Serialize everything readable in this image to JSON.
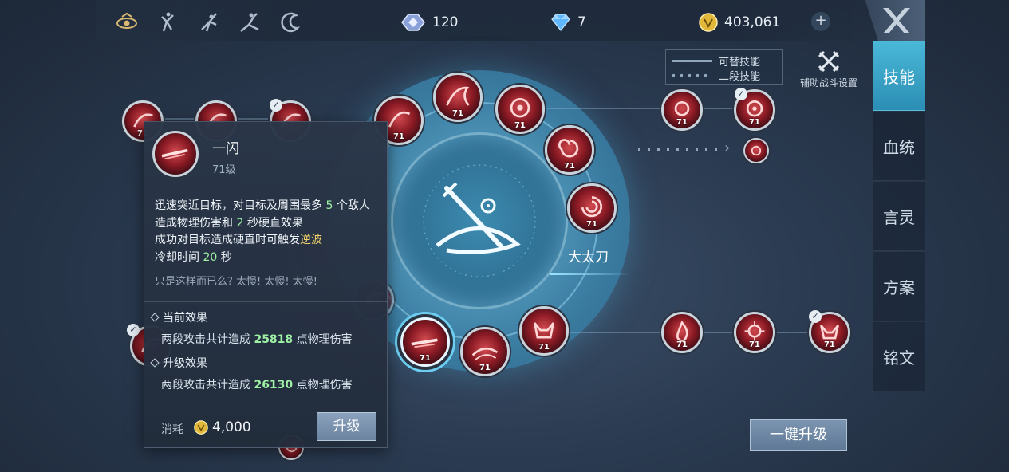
{
  "topbar": {
    "class_icons": [
      "eye-emblem-icon",
      "dancer-icon",
      "swordsman-icon",
      "archer-icon",
      "moon-swirl-icon"
    ],
    "crystal": {
      "icon": "crystal-icon",
      "value": "120"
    },
    "diamond": {
      "icon": "diamond-icon",
      "value": "7"
    },
    "gold": {
      "icon": "gold-coin-icon",
      "value": "403,061"
    },
    "add_label": "+",
    "close_icon": "close-x-icon"
  },
  "tabs": [
    {
      "label": "技能",
      "active": true
    },
    {
      "label": "血统",
      "active": false
    },
    {
      "label": "言灵",
      "active": false
    },
    {
      "label": "方案",
      "active": false
    },
    {
      "label": "铭文",
      "active": false
    }
  ],
  "legend": {
    "replace_label": "可替技能",
    "second_stage_label": "二段技能"
  },
  "assist": {
    "label": "辅助战斗设置",
    "icon": "crossed-swords-icon"
  },
  "wheel": {
    "weapon_name": "大太刀"
  },
  "skill_level": "71",
  "tooltip": {
    "name": "一闪",
    "level": "71级",
    "desc": {
      "l1a": "迅速突近目标，对目标及周围最多 ",
      "l1n": "5",
      "l1b": " 个敌人",
      "l2a": "造成物理伤害和 ",
      "l2n": "2",
      "l2b": " 秒硬直效果",
      "l3a": "成功对目标造成硬直时可触发",
      "l3k": "逆波",
      "l4a": "冷却时间 ",
      "l4n": "20",
      "l4b": " 秒"
    },
    "flavor": "只是这样而已么? 太慢! 太慢! 太慢!",
    "current_title": "当前效果",
    "current_a": "两段攻击共计造成 ",
    "current_n": "25818",
    "current_b": " 点物理伤害",
    "upgrade_title": "升级效果",
    "upgrade_a": "两段攻击共计造成 ",
    "upgrade_n": "26130",
    "upgrade_b": " 点物理伤害",
    "cost_label": "消耗",
    "cost_value": "4,000",
    "upgrade_button": "升级"
  },
  "one_key_upgrade": "一键升级",
  "colors": {
    "accent": "#4ab8d8",
    "skill_red": "#c23a44",
    "highlight_green": "#9ff2a5",
    "highlight_gold": "#f3d36b"
  }
}
